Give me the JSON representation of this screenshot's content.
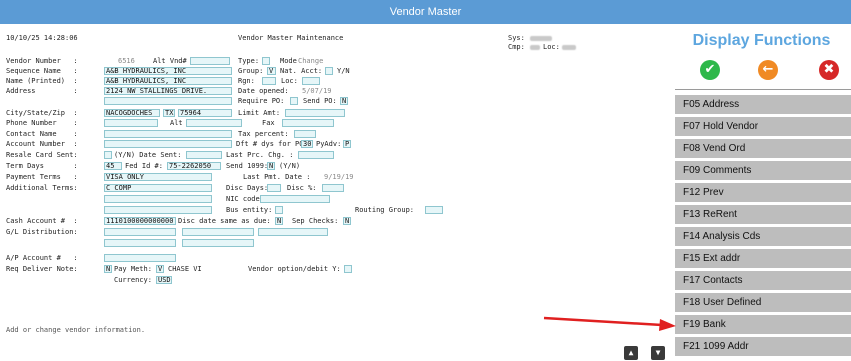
{
  "window": {
    "title": "Vendor Master"
  },
  "header": {
    "datetime": "10/10/25 14:28:06",
    "screen_title": "Vendor Master Maintenance",
    "sys_label": "Sys:",
    "cmp_label": "Cmp:",
    "loc_label": "Loc:"
  },
  "form": {
    "vendor_number_label": "Vendor Number   :",
    "vendor_number": "6516",
    "alt_vnd_label": "Alt Vnd#",
    "type_label": "Type:",
    "mode_label": "Mode",
    "mode_value": "Change",
    "sequence_name_label": "Sequence Name   :",
    "sequence_name": "A&B HYDRAULICS, INC",
    "group_label": "Group:",
    "group_value": "V",
    "nat_acct_label": "Nat. Acct:",
    "yn": "Y/N",
    "name_printed_label": "Name (Printed)  :",
    "name_printed": "A&B HYDRAULICS, INC",
    "rgn_label": "Rgn:",
    "loc_label": "Loc:",
    "address_label": "Address         :",
    "address1": "2124 NW STALLINGS DRIVE.",
    "date_opened_label": "Date opened:",
    "date_opened": "5/07/19",
    "require_po_label": "Require PO:",
    "send_po_label": "Send PO:",
    "send_po_value": "N",
    "city_label": "City/State/Zip  :",
    "city": "NACOGDOCHES",
    "state": "TX",
    "zip": "75964",
    "limit_amt_label": "Limit Amt:",
    "phone_label": "Phone Number    :",
    "alt_label": "Alt",
    "fax_label": "Fax",
    "contact_label": "Contact Name    :",
    "tax_percent_label": "Tax percent:",
    "account_number_label": "Account Number  :",
    "dft_days_label": "Dft # dys for PO:",
    "dft_days_value": "30",
    "pyadv_label": "PyAdv:",
    "pyadv_value": "P",
    "resale_label": "Resale Card Sent:",
    "resale_yn": "(Y/N) Date Sent:",
    "last_prc_label": "Last Prc. Chg. :",
    "term_days_label": "Term Days       :",
    "term_days": "45",
    "fed_id_label": "Fed Id #:",
    "fed_id": "75-2262050",
    "send_1099_label": "Send 1099:",
    "send_1099_value": "N",
    "send_1099_yn": "(Y/N)",
    "payment_terms_label": "Payment Terms   :",
    "payment_terms": "VISA ONLY",
    "last_pmt_label": "Last Pmt. Date :",
    "last_pmt_date": "9/19/19",
    "additional_terms_label": "Additional Terms:",
    "additional_terms": "C COMP",
    "disc_days_label": "Disc Days:",
    "disc_pct_label": "Disc %:",
    "nic_code_label": "NIC code:",
    "bus_entity_label": "Bus entity:",
    "routing_group_label": "Routing Group:",
    "cash_account_label": "Cash Account #  :",
    "cash_account": "1110100000000000",
    "disc_same_label": "Disc date same as due:",
    "disc_same_value": "N",
    "sep_checks_label": "Sep Checks:",
    "sep_checks_value": "N",
    "gl_dist_label": "G/L Distribution:",
    "ap_account_label": "A/P Account #   :",
    "req_deliver_label": "Req Deliver Note:",
    "req_deliver_value": "N",
    "pay_meth_label": "Pay Meth:",
    "pay_meth_value": "V",
    "pay_meth_desc": "CHASE VI",
    "vendor_option_label": "Vendor option/debit Y:",
    "currency_label": "Currency:",
    "currency_value": "USD"
  },
  "status_message": "Add or change vendor information.",
  "sidebar": {
    "title": "Display Functions",
    "actions": [
      {
        "icon": "check-icon",
        "color": "#2eb84a"
      },
      {
        "icon": "back-arrow-icon",
        "color": "#f08a24"
      },
      {
        "icon": "close-icon",
        "color": "#d62828"
      }
    ],
    "functions": [
      "F05 Address",
      "F07 Hold Vendor",
      "F08 Vend Ord",
      "F09 Comments",
      "F12 Prev",
      "F13 ReRent",
      "F14 Analysis Cds",
      "F15 Ext addr",
      "F17 Contacts",
      "F18 User Defined",
      "F19 Bank",
      "F21 1099 Addr"
    ]
  },
  "annotation": {
    "color": "#e02020"
  }
}
